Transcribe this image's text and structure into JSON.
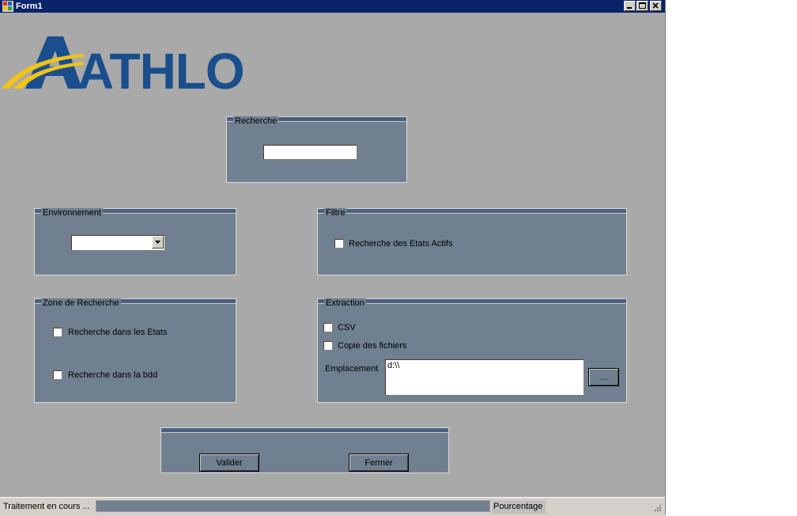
{
  "window": {
    "title": "Form1"
  },
  "logo": {
    "text": "ATHLON"
  },
  "recherche": {
    "legend": "Recherche",
    "value": ""
  },
  "environnement": {
    "legend": "Environnement",
    "selected": ""
  },
  "filtre": {
    "legend": "Filtre",
    "etats_actifs_label": "Recherche des Etats Actifs"
  },
  "zone": {
    "legend": "Zone de Recherche",
    "etats_label": "Recherche dans les Etats",
    "bdd_label": "Recherche dans la bdd"
  },
  "extraction": {
    "legend": "Extraction",
    "csv_label": "CSV",
    "copie_label": "Copie des fichiers",
    "emplacement_label": "Emplacement",
    "emplacement_value": "d:\\\\",
    "browse_label": "..."
  },
  "actions": {
    "valider": "Valider",
    "fermer": "Fermer"
  },
  "status": {
    "text": "Traitement en cours ...",
    "progress": 0,
    "pourcentage": "Pourcentage"
  },
  "colors": {
    "titlebar": "#0a246a",
    "background": "#a9a9a9",
    "group": "#708090",
    "logo_blue": "#1a4e8c",
    "logo_yellow": "#f2c318"
  }
}
